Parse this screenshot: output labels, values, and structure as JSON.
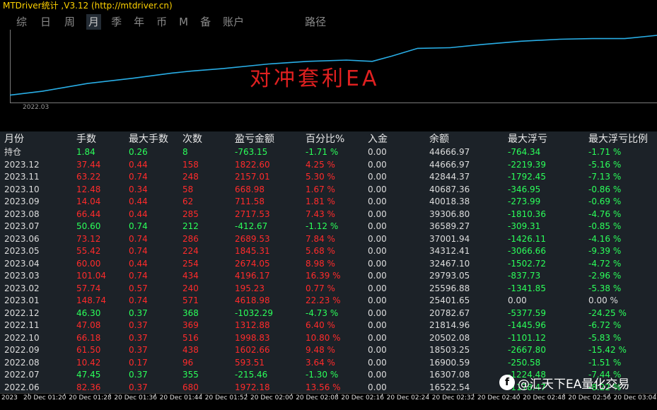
{
  "window": {
    "title": "MTDriver统计 ,V3.12 (http://mtdriver.cn)"
  },
  "tabs": [
    {
      "label": "综"
    },
    {
      "label": "日"
    },
    {
      "label": "周"
    },
    {
      "label": "月",
      "active": true
    },
    {
      "label": "季"
    },
    {
      "label": "年"
    },
    {
      "label": "币"
    },
    {
      "label": "M"
    },
    {
      "label": "备"
    },
    {
      "label": "账户"
    },
    {
      "label": "路径"
    }
  ],
  "equity_chart": {
    "overlay_text": "对冲套利EA",
    "start_label": "2022.03",
    "line_color": "#29aee6",
    "text_color": "#e02020",
    "points": [
      [
        0.0,
        0.92
      ],
      [
        0.05,
        0.86
      ],
      [
        0.12,
        0.74
      ],
      [
        0.19,
        0.66
      ],
      [
        0.25,
        0.58
      ],
      [
        0.28,
        0.55
      ],
      [
        0.33,
        0.51
      ],
      [
        0.4,
        0.44
      ],
      [
        0.46,
        0.4
      ],
      [
        0.52,
        0.38
      ],
      [
        0.56,
        0.4
      ],
      [
        0.59,
        0.32
      ],
      [
        0.63,
        0.2
      ],
      [
        0.68,
        0.19
      ],
      [
        0.73,
        0.14
      ],
      [
        0.79,
        0.09
      ],
      [
        0.85,
        0.06
      ],
      [
        0.9,
        0.05
      ],
      [
        0.95,
        0.05
      ],
      [
        1.0,
        0.0
      ]
    ]
  },
  "colors": {
    "positive": "#ff2b2b",
    "negative": "#2bff5a",
    "neutral": "#dddddd"
  },
  "table": {
    "headers": [
      "月份",
      "手数",
      "最大手数",
      "次数",
      "盈亏金额",
      "百分比%",
      "入金",
      "余额",
      "最大浮亏",
      "最大浮亏比例"
    ],
    "rows": [
      {
        "tone": "negative",
        "cells": [
          "持仓",
          "1.84",
          "0.26",
          "8",
          "-763.15",
          "-1.71 %",
          "0.00",
          "44666.97",
          "-764.34",
          "-1.71 %"
        ]
      },
      {
        "tone": "positive",
        "cells": [
          "2023.12",
          "37.44",
          "0.44",
          "158",
          "1822.60",
          "4.25 %",
          "0.00",
          "44666.97",
          "-2219.39",
          "-5.16 %"
        ]
      },
      {
        "tone": "positive",
        "cells": [
          "2023.11",
          "63.22",
          "0.74",
          "248",
          "2157.01",
          "5.30 %",
          "0.00",
          "42844.37",
          "-1792.45",
          "-7.13 %"
        ]
      },
      {
        "tone": "positive",
        "cells": [
          "2023.10",
          "12.48",
          "0.34",
          "58",
          "668.98",
          "1.67 %",
          "0.00",
          "40687.36",
          "-346.95",
          "-0.86 %"
        ]
      },
      {
        "tone": "positive",
        "cells": [
          "2023.09",
          "14.04",
          "0.44",
          "62",
          "711.58",
          "1.81 %",
          "0.00",
          "40018.38",
          "-273.99",
          "-0.69 %"
        ]
      },
      {
        "tone": "positive",
        "cells": [
          "2023.08",
          "66.44",
          "0.44",
          "285",
          "2717.53",
          "7.43 %",
          "0.00",
          "39306.80",
          "-1810.36",
          "-4.76 %"
        ]
      },
      {
        "tone": "negative",
        "cells": [
          "2023.07",
          "50.60",
          "0.74",
          "212",
          "-412.67",
          "-1.12 %",
          "0.00",
          "36589.27",
          "-309.31",
          "-0.85 %"
        ]
      },
      {
        "tone": "positive",
        "cells": [
          "2023.06",
          "73.12",
          "0.74",
          "286",
          "2689.53",
          "7.84 %",
          "0.00",
          "37001.94",
          "-1426.11",
          "-4.16 %"
        ]
      },
      {
        "tone": "positive",
        "cells": [
          "2023.05",
          "55.42",
          "0.74",
          "224",
          "1845.31",
          "5.68 %",
          "0.00",
          "34312.41",
          "-3066.66",
          "-9.39 %"
        ]
      },
      {
        "tone": "positive",
        "cells": [
          "2023.04",
          "60.00",
          "0.44",
          "254",
          "2674.05",
          "8.98 %",
          "0.00",
          "32467.10",
          "-1502.72",
          "-4.72 %"
        ]
      },
      {
        "tone": "positive",
        "cells": [
          "2023.03",
          "101.04",
          "0.74",
          "434",
          "4196.17",
          "16.39 %",
          "0.00",
          "29793.05",
          "-837.73",
          "-2.96 %"
        ]
      },
      {
        "tone": "positive",
        "cells": [
          "2023.02",
          "57.74",
          "0.57",
          "240",
          "195.23",
          "0.77 %",
          "0.00",
          "25596.88",
          "-1341.85",
          "-5.38 %"
        ]
      },
      {
        "tone": "positive",
        "cells": [
          "2023.01",
          "148.74",
          "0.74",
          "571",
          "4618.98",
          "22.23 %",
          "0.00",
          "25401.65",
          "0.00",
          "0.00 %"
        ]
      },
      {
        "tone": "negative",
        "cells": [
          "2022.12",
          "46.30",
          "0.37",
          "368",
          "-1032.29",
          "-4.73 %",
          "0.00",
          "20782.67",
          "-5377.59",
          "-24.25 %"
        ]
      },
      {
        "tone": "positive",
        "cells": [
          "2022.11",
          "47.08",
          "0.37",
          "369",
          "1312.88",
          "6.40 %",
          "0.00",
          "21814.96",
          "-1445.96",
          "-6.72 %"
        ]
      },
      {
        "tone": "positive",
        "cells": [
          "2022.10",
          "66.18",
          "0.37",
          "516",
          "1998.83",
          "10.80 %",
          "0.00",
          "20502.08",
          "-1101.12",
          "-5.83 %"
        ]
      },
      {
        "tone": "positive",
        "cells": [
          "2022.09",
          "61.50",
          "0.37",
          "438",
          "1602.66",
          "9.48 %",
          "0.00",
          "18503.25",
          "-2667.80",
          "-15.42 %"
        ]
      },
      {
        "tone": "positive",
        "cells": [
          "2022.08",
          "10.42",
          "0.17",
          "96",
          "593.51",
          "3.64 %",
          "0.00",
          "16900.59",
          "-250.58",
          "-1.51 %"
        ]
      },
      {
        "tone": "negative",
        "cells": [
          "2022.07",
          "47.45",
          "0.37",
          "355",
          "-215.46",
          "-1.30 %",
          "0.00",
          "16307.08",
          "-1224.48",
          "-7.44 %"
        ]
      },
      {
        "tone": "positive",
        "cells": [
          "2022.06",
          "82.36",
          "0.37",
          "680",
          "1972.18",
          "13.56 %",
          "0.00",
          "16522.54",
          "-1178.47",
          "-8.22 %"
        ]
      }
    ]
  },
  "time_axis": {
    "ticks": [
      "2023",
      "20 Dec 01:20",
      "20 Dec 01:28",
      "20 Dec 01:36",
      "20 Dec 01:44",
      "20 Dec 01:52",
      "20 Dec 02:00",
      "20 Dec 02:08",
      "20 Dec 02:16",
      "20 Dec 02:24",
      "20 Dec 02:32",
      "20 Dec 02:40",
      "20 Dec 02:48",
      "20 Dec 02:56",
      "20 Dec 03:04"
    ]
  },
  "watermark": {
    "icon": "social-logo-icon",
    "icon_text": "f",
    "text": "@汇天下EA量化交易"
  }
}
